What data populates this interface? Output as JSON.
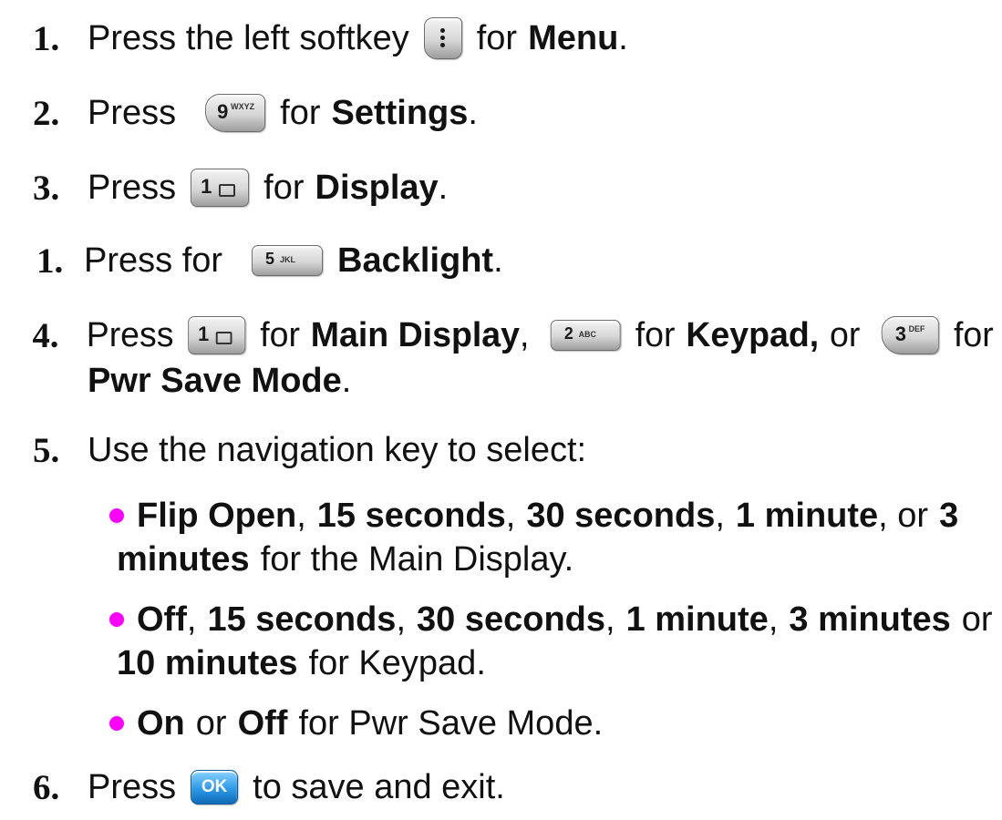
{
  "steps": {
    "s1": {
      "num": "1.",
      "press": "Press the left softkey",
      "for": "for",
      "bold": "Menu",
      "end": "."
    },
    "s2": {
      "num": "2.",
      "press": "Press",
      "for": "for",
      "bold": "Settings",
      "end": ".",
      "key_big": "9",
      "key_small": "WXYZ"
    },
    "s3": {
      "num": "3.",
      "press": "Press",
      "for": "for",
      "bold": "Display",
      "end": ".",
      "key_big": "1"
    },
    "s4": {
      "num": "1.",
      "press": "Press for",
      "bold": "Backlight",
      "end": ".",
      "key_big": "5",
      "key_small": "JKL"
    },
    "s5": {
      "num": "4.",
      "press": "Press",
      "for": "for",
      "main": "Main Display",
      "comma": ",",
      "keypad": "Keypad,",
      "or": "or",
      "pwr": "Pwr Save Mode",
      "end": ".",
      "key1": "1",
      "key2": "2",
      "key2_small": "ABC",
      "key3": "3",
      "key3_small": "DEF"
    },
    "s6": {
      "num": "5.",
      "text": "Use the navigation key to select:"
    },
    "bullet1": {
      "a": "Flip Open",
      "c1": ",",
      "b": "15 seconds",
      "c2": ",",
      "c": "30 seconds",
      "c3": ",",
      "d": "1 minute",
      "c4": ", or",
      "e": "3",
      "f": "minutes",
      "tail": "for the Main Display."
    },
    "bullet2": {
      "a": "Off",
      "c1": ",",
      "b": "15 seconds",
      "c2": ",",
      "c": "30 seconds",
      "c3": ",",
      "d": "1 minute",
      "c4": ",",
      "e": "3 minutes",
      "or": "or",
      "f": "10 minutes",
      "tail": "for Keypad."
    },
    "bullet3": {
      "a": "On",
      "or": "or",
      "b": "Off",
      "tail": "for Pwr Save Mode."
    },
    "s7": {
      "num": "6.",
      "press": "Press",
      "key": "OK",
      "tail": "to save and exit."
    }
  },
  "colors": {
    "bullet": "#ff00ff",
    "ok_key": "#2d9ae8",
    "text": "#111111"
  },
  "icons": [
    "left-softkey-icon",
    "key-9-wxyz-icon",
    "key-1-icon",
    "key-5-jkl-icon",
    "key-2-abc-icon",
    "key-3-def-icon",
    "ok-key-icon"
  ]
}
